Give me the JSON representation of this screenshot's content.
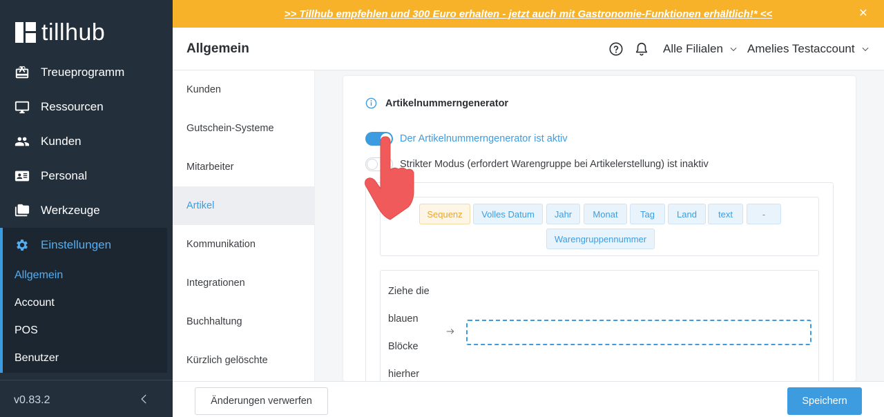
{
  "app": {
    "logo_text": "tillhub"
  },
  "banner": {
    "text": ">> Tillhub empfehlen und 300 Euro erhalten - jetzt auch mit Gastronomie-Funktionen erhältlich!* <<",
    "close": "✕"
  },
  "header": {
    "title": "Allgemein",
    "branch": "Alle Filialen",
    "account": "Amelies Testaccount"
  },
  "sidebar": {
    "items": [
      {
        "label": "Treueprogramm",
        "icon": "gift-card-icon"
      },
      {
        "label": "Ressourcen",
        "icon": "monitor-icon"
      },
      {
        "label": "Kunden",
        "icon": "people-icon"
      },
      {
        "label": "Personal",
        "icon": "id-card-icon"
      },
      {
        "label": "Werkzeuge",
        "icon": "folder-icon"
      },
      {
        "label": "Einstellungen",
        "icon": "gear-icon"
      }
    ],
    "subitems": [
      "Allgemein",
      "Account",
      "POS",
      "Benutzer"
    ],
    "version": "v0.83.2"
  },
  "subnav": {
    "items": [
      "Kunden",
      "Gutschein-Systeme",
      "Mitarbeiter",
      "Artikel",
      "Kommunikation",
      "Integrationen",
      "Buchhaltung",
      "Kürzlich gelöschte"
    ]
  },
  "section": {
    "title": "Artikelnummerngenerator",
    "toggle1_label": "Der Artikelnummerngenerator ist aktiv",
    "toggle2_label": "Strikter Modus (erfordert Warengruppe bei Artikelerstellung) ist inaktiv",
    "toggle1_on": true,
    "toggle2_on": false
  },
  "blocks": [
    "Sequenz",
    "Volles Datum",
    "Jahr",
    "Monat",
    "Tag",
    "Land",
    "text",
    "-",
    "Warengruppennummer"
  ],
  "dropzone": {
    "hint_lines": [
      "Ziehe die",
      "blauen",
      "Blöcke",
      "hierher"
    ]
  },
  "footer": {
    "discard": "Änderungen verwerfen",
    "save": "Speichern"
  },
  "colors": {
    "accent": "#3d9ce0",
    "banner": "#f8b22a",
    "sidebar": "#232f3b",
    "sequence_chip": "#eba52c",
    "pointer_hand": "#f05a5a"
  }
}
